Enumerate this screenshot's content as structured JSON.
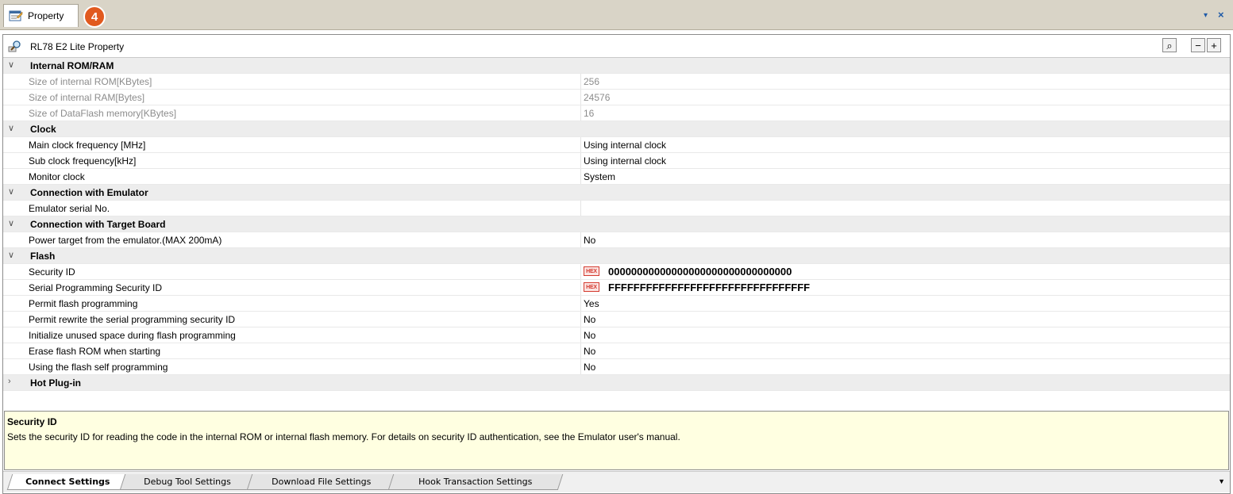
{
  "window": {
    "tab_label": "Property",
    "badge": "4",
    "pin_glyph": "▾",
    "close_glyph": "×"
  },
  "panel": {
    "title": "RL78 E2 Lite Property",
    "search_glyph": "⌕",
    "collapse_glyph": "−",
    "expand_glyph": "+"
  },
  "categories": [
    {
      "label": "Internal ROM/RAM",
      "expanded": true,
      "rows": [
        {
          "name": "Size of internal ROM[KBytes]",
          "value": "256",
          "readonly": true
        },
        {
          "name": "Size of internal RAM[Bytes]",
          "value": "24576",
          "readonly": true
        },
        {
          "name": "Size of DataFlash memory[KBytes]",
          "value": "16",
          "readonly": true
        }
      ]
    },
    {
      "label": "Clock",
      "expanded": true,
      "rows": [
        {
          "name": "Main clock frequency [MHz]",
          "value": "Using internal clock"
        },
        {
          "name": "Sub clock frequency[kHz]",
          "value": "Using internal clock"
        },
        {
          "name": "Monitor clock",
          "value": "System"
        }
      ]
    },
    {
      "label": "Connection with Emulator",
      "expanded": true,
      "rows": [
        {
          "name": "Emulator serial No.",
          "value": ""
        }
      ]
    },
    {
      "label": "Connection with Target Board",
      "expanded": true,
      "rows": [
        {
          "name": "Power target from the emulator.(MAX 200mA)",
          "value": "No"
        }
      ]
    },
    {
      "label": "Flash",
      "expanded": true,
      "rows": [
        {
          "name": "Security ID",
          "value": "00000000000000000000000000000000",
          "hex": true
        },
        {
          "name": "Serial Programming Security ID",
          "value": "FFFFFFFFFFFFFFFFFFFFFFFFFFFFFFFF",
          "hex": true
        },
        {
          "name": "Permit flash programming",
          "value": "Yes"
        },
        {
          "name": "Permit rewrite the serial programming security ID",
          "value": "No"
        },
        {
          "name": "Initialize unused space during flash programming",
          "value": "No"
        },
        {
          "name": "Erase flash ROM when starting",
          "value": "No"
        },
        {
          "name": "Using the flash self programming",
          "value": "No"
        }
      ]
    },
    {
      "label": "Hot Plug-in",
      "expanded": false,
      "rows": []
    }
  ],
  "hex_badge": "HEX",
  "chevron_expanded": "∨",
  "chevron_collapsed": "›",
  "description": {
    "title": "Security ID",
    "text": "Sets the security ID for reading the code in the internal ROM or internal flash memory. For details on security ID authentication, see the Emulator user's manual."
  },
  "bottom_tabs": [
    {
      "label": "Connect Settings",
      "active": true
    },
    {
      "label": "Debug Tool Settings",
      "active": false
    },
    {
      "label": "Download File Settings",
      "active": false
    },
    {
      "label": "Hook Transaction Settings",
      "active": false
    }
  ],
  "bottom_dropdown_glyph": "▼"
}
